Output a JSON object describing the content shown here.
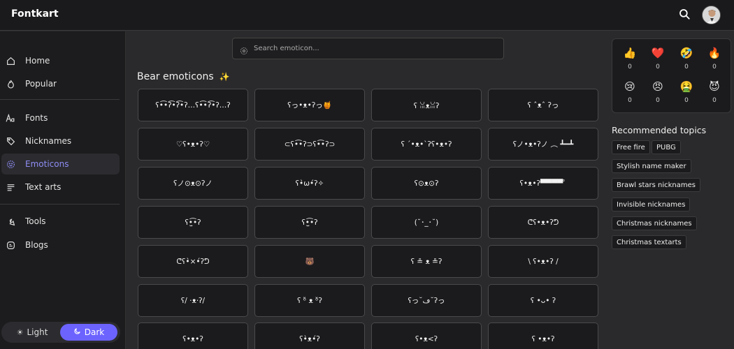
{
  "header": {
    "logo": "Fontkart"
  },
  "sidebar": {
    "items": [
      {
        "label": "Home",
        "icon": "home-icon"
      },
      {
        "label": "Popular",
        "icon": "flame-icon"
      },
      {
        "label": "Fonts",
        "icon": "font-icon"
      },
      {
        "label": "Nicknames",
        "icon": "tag-icon"
      },
      {
        "label": "Emoticons",
        "icon": "emoticon-icon",
        "active": true
      },
      {
        "label": "Text arts",
        "icon": "text-art-icon"
      },
      {
        "label": "Tools",
        "icon": "tools-icon"
      },
      {
        "label": "Blogs",
        "icon": "blog-icon"
      }
    ],
    "theme": {
      "light_label": "Light",
      "dark_label": "Dark",
      "selected": "Dark"
    }
  },
  "search": {
    "placeholder": "Search emoticon..."
  },
  "section": {
    "title": "Bear emoticons"
  },
  "emoticons": [
    "ʕ•͡•ʔ͡•ʔ͡•ʔ…ʕ•͡•ʔ͡•ʔ…ʔ",
    "ʕっ•ᴥ•ʔっ🍯",
    "ʕ ꈍᴥꈍʔ",
    "ʕ ˆᴥˆ ʔっ",
    "♡ʕ•ᴥ•ʔ♡",
    "⊂ʕ•͡•ʔ⊃ʕ•͡•ʔ⊃",
    "ʕ ´•ᴥ•`ʔʕ•ᴥ•ʔ",
    "ʕノ•ᴥ•ʔノ ︵ ┻━┻",
    "ʕノ⊙ᴥ⊙ʔノ",
    "ʕ•̀ω•́ʔ✧",
    "ʕ⊙ᴥ⊙ʔ",
    "ʕ•ᴥ•ʔ▀▀▀▀ﾟ",
    "ʕ•̫͡•ʔ",
    "ʕ•̫͡•ʔ",
    "(˘･_･˘)",
    "ᕦʕ•ᴥ•ʔᕤ",
    "ᕦʕ•̀×•́ʔᕤ",
    "🐻",
    "ʕ ≗ ᴥ ≗ʔ",
    "\\ ʕ•ᴥ•ʔ /",
    "ʕ/ ·ᴥ·ʔ/",
    "ʕ ᵒ̌ ᴥ ᵒ̌ʔ",
    "ʕっ˘ڡ˘ʔっ",
    "ʕ •ᴗ• ʔ",
    "ʕ•ᴥ•ʔ",
    "ʕ•̀ᴥ•́ʔ",
    "ʕ•ᴥ<ʔ",
    "ʕ •ᴥ•ʔ"
  ],
  "reactions": [
    {
      "emoji": "👍",
      "count": "0",
      "icon": "thumbs-up-icon"
    },
    {
      "emoji": "❤️",
      "count": "0",
      "icon": "heart-icon"
    },
    {
      "emoji": "🤣",
      "count": "0",
      "icon": "laughing-icon"
    },
    {
      "emoji": "🔥",
      "count": "0",
      "icon": "fire-icon"
    },
    {
      "emoji": "😢",
      "count": "0",
      "icon": "sad-icon"
    },
    {
      "emoji": "😠",
      "count": "0",
      "icon": "angry-icon"
    },
    {
      "emoji": "🤮",
      "count": "0",
      "icon": "vomit-icon"
    },
    {
      "emoji": "😈",
      "count": "0",
      "icon": "devil-icon"
    }
  ],
  "topics": {
    "title": "Recommended topics",
    "items": [
      "Free fire",
      "PUBG",
      "Stylish name maker",
      "Brawl stars nicknames",
      "Invisible nicknames",
      "Christmas nicknames",
      "Christmas textarts"
    ]
  }
}
